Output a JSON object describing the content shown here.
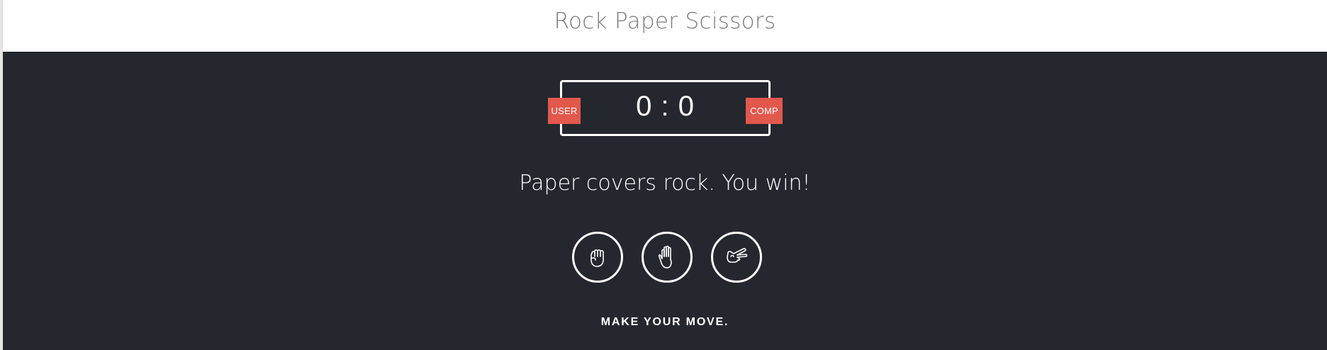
{
  "header": {
    "title": "Rock Paper Scissors"
  },
  "scoreboard": {
    "user_label": "USER",
    "comp_label": "COMP",
    "user_score": "0",
    "separator": ":",
    "comp_score": "0"
  },
  "result": {
    "message": "Paper covers rock. You win!"
  },
  "choices": [
    {
      "name": "rock",
      "icon": "fist-icon"
    },
    {
      "name": "paper",
      "icon": "open-hand-icon"
    },
    {
      "name": "scissors",
      "icon": "scissors-hand-icon"
    }
  ],
  "prompt": {
    "text": "MAKE YOUR MOVE."
  },
  "colors": {
    "header_bg": "#ffffff",
    "title_text": "#7a7a7a",
    "main_bg": "#24272e",
    "badge_bg": "#e2584d",
    "foreground": "#ffffff"
  }
}
